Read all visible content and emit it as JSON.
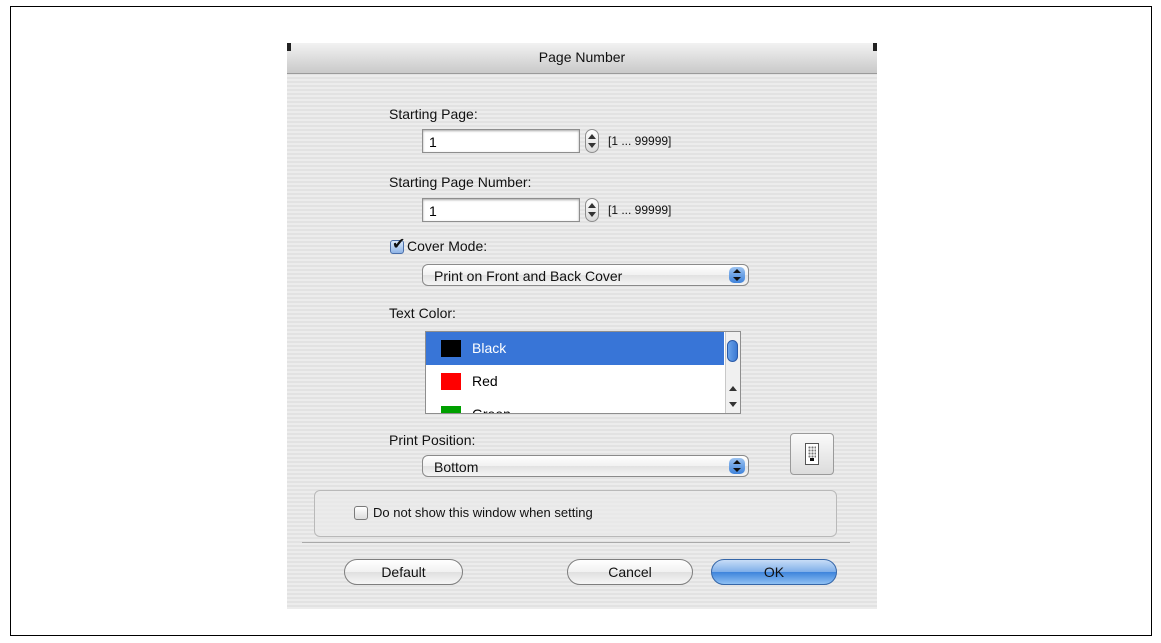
{
  "dialog": {
    "title": "Page Number",
    "starting_page": {
      "label": "Starting Page:",
      "value": "1",
      "range": "[1 ... 99999]"
    },
    "starting_page_number": {
      "label": "Starting Page Number:",
      "value": "1",
      "range": "[1 ... 99999]"
    },
    "cover_mode": {
      "label": "Cover Mode:",
      "checked": true,
      "selected": "Print on Front and Back Cover"
    },
    "text_color": {
      "label": "Text Color:",
      "items": [
        {
          "label": "Black",
          "color": "#000000",
          "selected": true
        },
        {
          "label": "Red",
          "color": "#ff0000",
          "selected": false
        },
        {
          "label": "Green",
          "color": "#00a000",
          "selected": false
        }
      ]
    },
    "print_position": {
      "label": "Print Position:",
      "selected": "Bottom"
    },
    "do_not_show": {
      "label": "Do not show this window when setting",
      "checked": false
    },
    "buttons": {
      "default": "Default",
      "cancel": "Cancel",
      "ok": "OK"
    }
  }
}
